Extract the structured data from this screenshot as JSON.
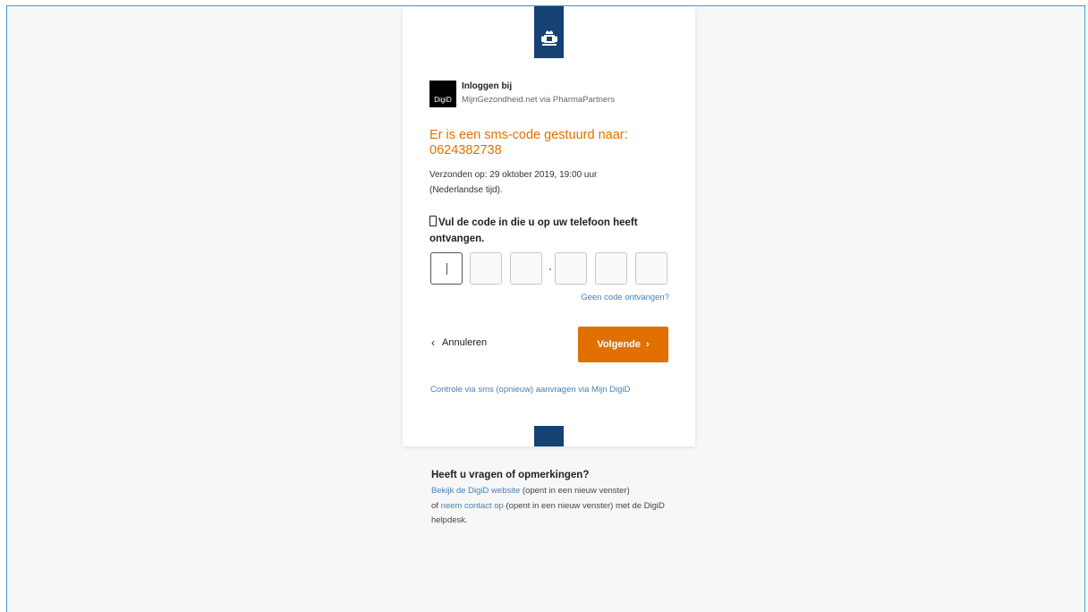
{
  "header": {
    "emblem_icon": "rijksoverheid-crest-icon",
    "band_color": "#154273"
  },
  "app": {
    "logo_text": "DigiD",
    "login_label": "Inloggen bij",
    "login_target": "MijnGezondheid.net via PharmaPartners"
  },
  "sms": {
    "title": "Er is een sms-code gestuurd naar: 0624382738",
    "sent_info": "Verzonden op: 29 oktober 2019, 19:00 uur (Nederlandse tijd).",
    "enter_code_label": "Vul de code in die u op uw telefoon heeft ontvangen.",
    "code_digits": [
      "",
      "",
      "",
      "",
      "",
      ""
    ],
    "no_code_link": "Geen code ontvangen?"
  },
  "actions": {
    "cancel_label": "Annuleren",
    "next_label": "Volgende",
    "next_color": "#e17000",
    "sms_request_link": "Controle via sms (opnieuw) aanvragen via Mijn DigiD"
  },
  "help": {
    "title": "Heeft u vragen of opmerkingen?",
    "link1": "Bekijk de DigiD website",
    "text1": " (opent in een nieuw venster)",
    "text2": "of ",
    "link2": "neem contact op",
    "text3": " (opent in een nieuw venster) met de DigiD helpdesk."
  }
}
